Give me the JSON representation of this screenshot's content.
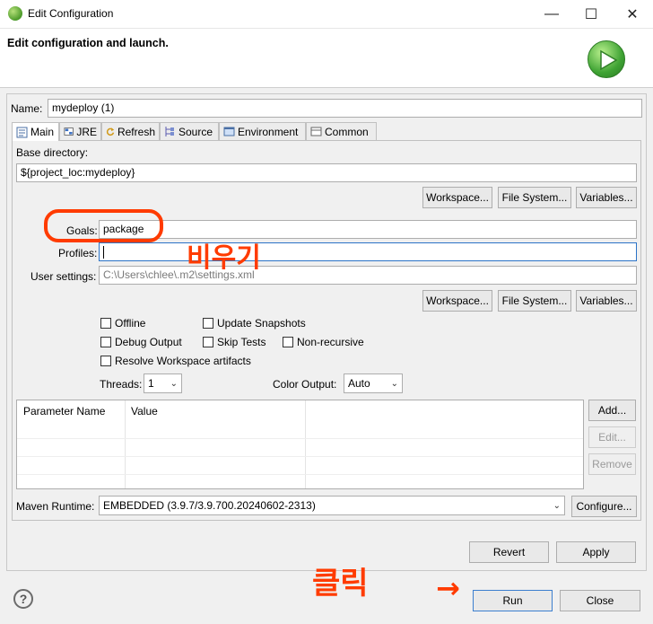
{
  "window": {
    "title": "Edit Configuration",
    "minimize_glyph": "—",
    "maximize_glyph": "☐",
    "close_glyph": "✕"
  },
  "header": {
    "title": "Edit configuration and launch."
  },
  "name": {
    "label": "Name:",
    "value": "mydeploy (1)"
  },
  "tabs": [
    {
      "label": "Main",
      "icon": "main-tab-icon",
      "active": true
    },
    {
      "label": "JRE",
      "icon": "jre-tab-icon"
    },
    {
      "label": "Refresh",
      "icon": "refresh-tab-icon"
    },
    {
      "label": "Source",
      "icon": "source-tab-icon"
    },
    {
      "label": "Environment",
      "icon": "environment-tab-icon"
    },
    {
      "label": "Common",
      "icon": "common-tab-icon"
    }
  ],
  "main": {
    "base_dir_label": "Base directory:",
    "base_dir_value": "${project_loc:mydeploy}",
    "workspace_btn": "Workspace...",
    "filesystem_btn": "File System...",
    "variables_btn": "Variables...",
    "goals_label": "Goals:",
    "goals_value": "package",
    "profiles_label": "Profiles:",
    "profiles_value": "",
    "user_settings_label": "User settings:",
    "user_settings_value": "C:\\Users\\chlee\\.m2\\settings.xml",
    "checkboxes": {
      "offline": "Offline",
      "update_snapshots": "Update Snapshots",
      "debug_output": "Debug Output",
      "skip_tests": "Skip Tests",
      "non_recursive": "Non-recursive",
      "resolve_workspace": "Resolve Workspace artifacts"
    },
    "threads_label": "Threads:",
    "threads_value": "1",
    "color_output_label": "Color Output:",
    "color_output_value": "Auto",
    "table_headers": [
      "Parameter Name",
      "Value"
    ],
    "add_btn": "Add...",
    "edit_btn": "Edit...",
    "remove_btn": "Remove",
    "maven_runtime_label": "Maven Runtime:",
    "maven_runtime_value": "EMBEDDED (3.9.7/3.9.700.20240602-2313)",
    "configure_btn": "Configure..."
  },
  "footer": {
    "revert_btn": "Revert",
    "apply_btn": "Apply",
    "run_btn": "Run",
    "close_btn": "Close",
    "help_glyph": "?"
  },
  "annotations": {
    "empty_note": "비우기",
    "click_note": "클릭",
    "arrow": "→",
    "color": "#ff3b00"
  }
}
